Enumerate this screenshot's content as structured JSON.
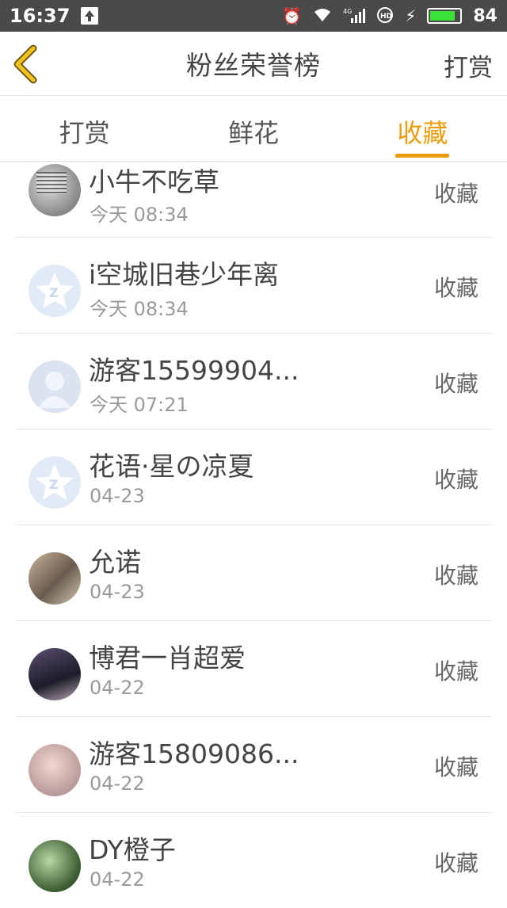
{
  "status_bar": {
    "time": "16:37",
    "battery": "84",
    "battery_level": 0.84,
    "network": "4G"
  },
  "header": {
    "title": "粉丝荣誉榜",
    "right_action": "打赏"
  },
  "tabs": [
    {
      "label": "打赏",
      "active": false
    },
    {
      "label": "鲜花",
      "active": false
    },
    {
      "label": "收藏",
      "active": true
    }
  ],
  "accent_color": "#ee9c0b",
  "fans": [
    {
      "name": "小牛不吃草",
      "time": "今天 08:34",
      "action": "收藏",
      "avatar": "photo-avatar"
    },
    {
      "name": "i空城旧巷少年离",
      "time": "今天 08:34",
      "action": "收藏",
      "avatar": "qq-default-avatar"
    },
    {
      "name": "游客15599904...",
      "time": "今天 07:21",
      "action": "收藏",
      "avatar": "guest-default-avatar"
    },
    {
      "name": "花语·星の凉夏",
      "time": "04-23",
      "action": "收藏",
      "avatar": "qq-default-avatar"
    },
    {
      "name": "允诺",
      "time": "04-23",
      "action": "收藏",
      "avatar": "photo-avatar"
    },
    {
      "name": "博君一肖超爱",
      "time": "04-22",
      "action": "收藏",
      "avatar": "photo-avatar"
    },
    {
      "name": "游客15809086...",
      "time": "04-22",
      "action": "收藏",
      "avatar": "photo-avatar"
    },
    {
      "name": "DY橙子",
      "time": "04-22",
      "action": "收藏",
      "avatar": "photo-avatar"
    }
  ]
}
